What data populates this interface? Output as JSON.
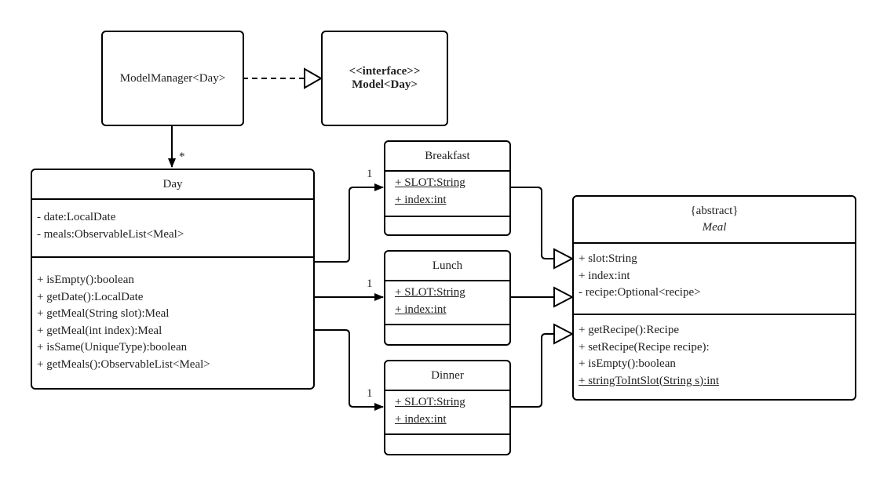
{
  "diagram": {
    "type": "uml-class-diagram",
    "classes": {
      "model_manager": {
        "name": "ModelManager<Day>"
      },
      "model": {
        "stereotype": "<<interface>>",
        "name": "Model<Day>"
      },
      "day": {
        "name": "Day",
        "attributes": [
          "- date:LocalDate",
          "- meals:ObservableList<Meal>"
        ],
        "methods": [
          "+ isEmpty():boolean",
          "+ getDate():LocalDate",
          "+ getMeal(String slot):Meal",
          "+ getMeal(int index):Meal",
          "+ isSame(UniqueType):boolean",
          "+ getMeals():ObservableList<Meal>"
        ]
      },
      "breakfast": {
        "name": "Breakfast",
        "attributes": [
          "+ SLOT:String",
          "+ index:int"
        ]
      },
      "lunch": {
        "name": "Lunch",
        "attributes": [
          "+ SLOT:String",
          "+ index:int"
        ]
      },
      "dinner": {
        "name": "Dinner",
        "attributes": [
          "+ SLOT:String",
          "+ index:int"
        ]
      },
      "meal": {
        "stereotype": "{abstract}",
        "name": "Meal",
        "attributes": [
          "+ slot:String",
          "+ index:int",
          "- recipe:Optional<recipe>"
        ],
        "methods": [
          "+ getRecipe():Recipe",
          "+ setRecipe(Recipe recipe):",
          "+ isEmpty():boolean",
          "+ stringToIntSlot(String s):int"
        ]
      }
    },
    "multiplicities": {
      "manager_to_day": "*",
      "day_to_breakfast": "1",
      "day_to_lunch": "1",
      "day_to_dinner": "1"
    },
    "relationships": [
      {
        "from": "ModelManager<Day>",
        "to": "Model<Day>",
        "kind": "realization"
      },
      {
        "from": "ModelManager<Day>",
        "to": "Day",
        "kind": "association",
        "multiplicity": "*"
      },
      {
        "from": "Day",
        "to": "Breakfast",
        "kind": "association",
        "multiplicity": "1"
      },
      {
        "from": "Day",
        "to": "Lunch",
        "kind": "association",
        "multiplicity": "1"
      },
      {
        "from": "Day",
        "to": "Dinner",
        "kind": "association",
        "multiplicity": "1"
      },
      {
        "from": "Breakfast",
        "to": "Meal",
        "kind": "generalization"
      },
      {
        "from": "Lunch",
        "to": "Meal",
        "kind": "generalization"
      },
      {
        "from": "Dinner",
        "to": "Meal",
        "kind": "generalization"
      }
    ]
  }
}
